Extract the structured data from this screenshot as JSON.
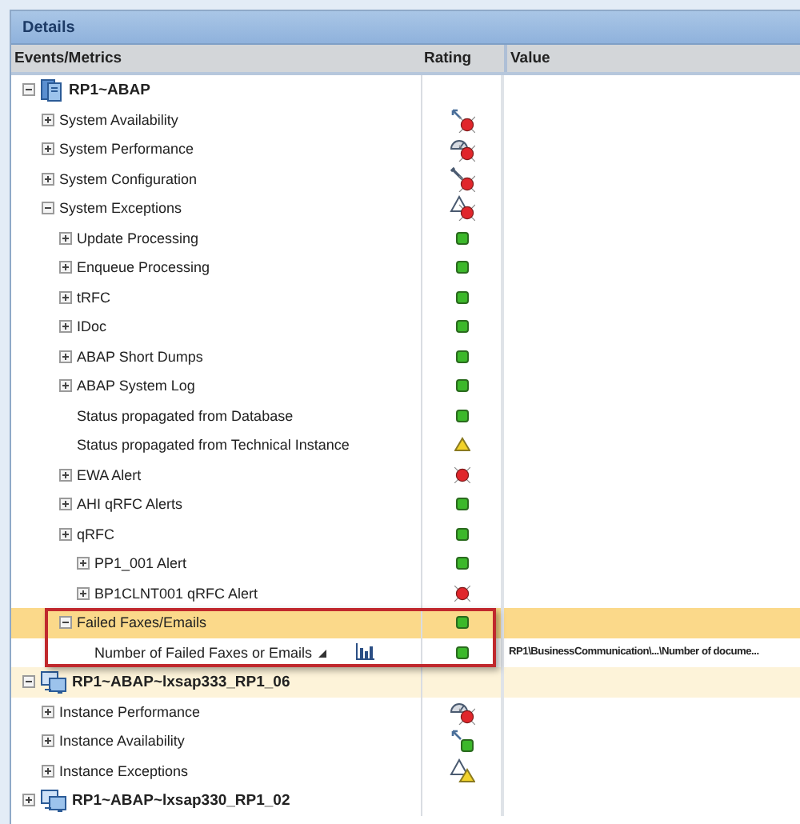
{
  "panel": {
    "title": "Details"
  },
  "columns": [
    "Events/Metrics",
    "Rating",
    "Value"
  ],
  "tree": [
    {
      "label": "RP1~ABAP",
      "kind": "system",
      "expanded": true,
      "selected": false,
      "highlighted": false,
      "children": [
        {
          "label": "System Availability",
          "expanded": false,
          "selected": false,
          "highlighted": false,
          "rating": {
            "kind": "availability-alert",
            "color": "#e0262b"
          }
        },
        {
          "label": "System Performance",
          "expanded": false,
          "selected": false,
          "highlighted": false,
          "rating": {
            "kind": "performance-alert",
            "color": "#e0262b"
          }
        },
        {
          "label": "System Configuration",
          "expanded": false,
          "selected": false,
          "highlighted": false,
          "rating": {
            "kind": "configuration-alert",
            "color": "#e0262b"
          }
        },
        {
          "label": "System Exceptions",
          "expanded": true,
          "selected": false,
          "highlighted": false,
          "rating": {
            "kind": "exceptions-alert",
            "color": "#e0262b"
          },
          "children": [
            {
              "label": "Update Processing",
              "expanded": false,
              "selected": false,
              "highlighted": false,
              "rating": {
                "kind": "ok",
                "color": "#3cb82a"
              }
            },
            {
              "label": "Enqueue Processing",
              "expanded": false,
              "selected": false,
              "highlighted": false,
              "rating": {
                "kind": "ok",
                "color": "#3cb82a"
              }
            },
            {
              "label": "tRFC",
              "expanded": false,
              "selected": false,
              "highlighted": false,
              "rating": {
                "kind": "ok",
                "color": "#3cb82a"
              }
            },
            {
              "label": "IDoc",
              "expanded": false,
              "selected": false,
              "highlighted": false,
              "rating": {
                "kind": "ok",
                "color": "#3cb82a"
              }
            },
            {
              "label": "ABAP Short Dumps",
              "expanded": false,
              "selected": false,
              "highlighted": false,
              "rating": {
                "kind": "ok",
                "color": "#3cb82a"
              }
            },
            {
              "label": "ABAP System Log",
              "expanded": false,
              "selected": false,
              "highlighted": false,
              "rating": {
                "kind": "ok",
                "color": "#3cb82a"
              }
            },
            {
              "label": "Status propagated from Database",
              "selected": false,
              "highlighted": false,
              "rating": {
                "kind": "ok",
                "color": "#3cb82a"
              }
            },
            {
              "label": "Status propagated from Technical Instance",
              "selected": false,
              "highlighted": false,
              "rating": {
                "kind": "warning",
                "color": "#f2d22a"
              }
            },
            {
              "label": "EWA Alert",
              "expanded": false,
              "selected": false,
              "highlighted": false,
              "rating": {
                "kind": "alert",
                "color": "#e0262b"
              }
            },
            {
              "label": "AHI qRFC Alerts",
              "expanded": false,
              "selected": false,
              "highlighted": false,
              "rating": {
                "kind": "ok",
                "color": "#3cb82a"
              }
            },
            {
              "label": "qRFC",
              "expanded": false,
              "selected": false,
              "highlighted": false,
              "rating": {
                "kind": "ok",
                "color": "#3cb82a"
              },
              "children": [
                {
                  "label": "PP1_001 Alert",
                  "expanded": false,
                  "selected": false,
                  "highlighted": false,
                  "rating": {
                    "kind": "ok",
                    "color": "#3cb82a"
                  }
                },
                {
                  "label": "BP1CLNT001 qRFC Alert",
                  "expanded": false,
                  "selected": false,
                  "highlighted": false,
                  "rating": {
                    "kind": "alert",
                    "color": "#e0262b"
                  }
                }
              ]
            },
            {
              "label": "Failed Faxes/Emails",
              "expanded": true,
              "selected": true,
              "highlighted": false,
              "boxed": true,
              "rating": {
                "kind": "ok",
                "color": "#3cb82a"
              },
              "children": [
                {
                  "label": "Number of Failed Faxes or Emails",
                  "kind": "metric",
                  "selected": false,
                  "highlighted": false,
                  "rating": {
                    "kind": "ok",
                    "color": "#3cb82a"
                  },
                  "value": "RP1\\BusinessCommunication\\...\\Number of docume..."
                }
              ]
            }
          ]
        }
      ]
    },
    {
      "label": "RP1~ABAP~lxsap333_RP1_06",
      "kind": "instance",
      "expanded": true,
      "selected": false,
      "highlighted": true,
      "children": [
        {
          "label": "Instance Performance",
          "expanded": false,
          "selected": false,
          "highlighted": false,
          "rating": {
            "kind": "performance-alert",
            "color": "#e0262b"
          }
        },
        {
          "label": "Instance Availability",
          "expanded": false,
          "selected": false,
          "highlighted": false,
          "rating": {
            "kind": "availability-ok",
            "color": "#3cb82a"
          }
        },
        {
          "label": "Instance Exceptions",
          "expanded": false,
          "selected": false,
          "highlighted": false,
          "rating": {
            "kind": "exceptions-warning",
            "color": "#f2d22a"
          }
        }
      ]
    },
    {
      "label": "RP1~ABAP~lxsap330_RP1_02",
      "kind": "instance",
      "expanded": false,
      "selected": false,
      "highlighted": false
    }
  ]
}
